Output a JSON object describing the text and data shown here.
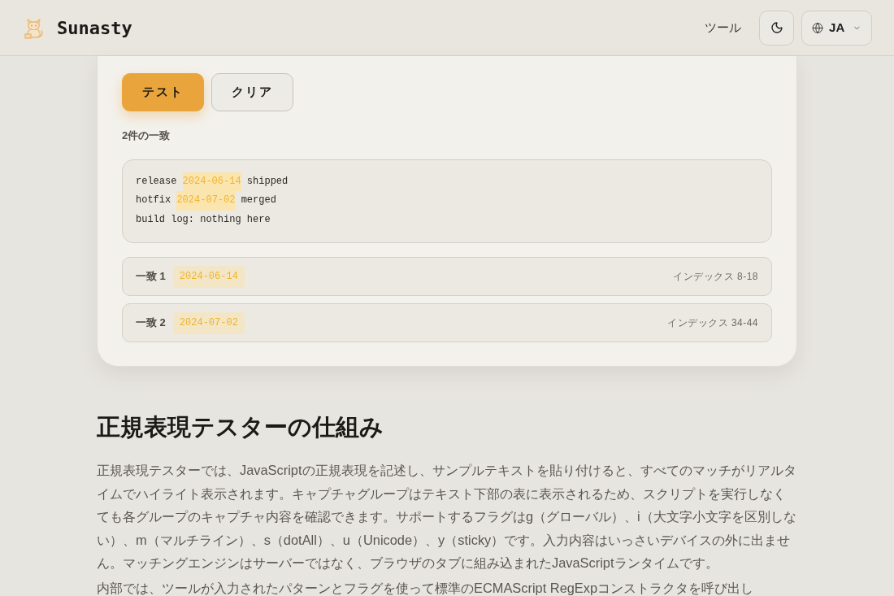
{
  "header": {
    "brand": "Sunasty",
    "nav": [
      {
        "label": "ツール"
      }
    ],
    "language": "JA"
  },
  "tester": {
    "buttons": [
      {
        "label": "テスト",
        "kind": "primary"
      },
      {
        "label": "クリア",
        "kind": "secondary"
      }
    ],
    "match_count": "2件の一致",
    "sample_lines": [
      [
        {
          "text": "release ",
          "highlighted": false
        },
        {
          "text": "2024-06-14",
          "highlighted": true
        },
        {
          "text": " shipped",
          "highlighted": false
        }
      ],
      [
        {
          "text": "hotfix ",
          "highlighted": false
        },
        {
          "text": "2024-07-02",
          "highlighted": true
        },
        {
          "text": " merged",
          "highlighted": false
        }
      ],
      [
        {
          "text": "build log: nothing here",
          "highlighted": false
        }
      ]
    ],
    "matches": [
      {
        "label": "一致 1",
        "value": "2024-06-14",
        "index": "インデックス 8-18"
      },
      {
        "label": "一致 2",
        "value": "2024-07-02",
        "index": "インデックス 34-44"
      }
    ]
  },
  "article": {
    "heading": "正規表現テスターの仕組み",
    "paragraphs": [
      "正規表現テスターでは、JavaScriptの正規表現を記述し、サンプルテキストを貼り付けると、すべてのマッチがリアルタイムでハイライト表示されます。キャプチャグループはテキスト下部の表に表示されるため、スクリプトを実行しなくても各グループのキャプチャ内容を確認できます。サポートするフラグはg（グローバル）、i（大文字小文字を区別しない）、m（マルチライン）、s（dotAll）、u（Unicode）、y（sticky）です。入力内容はいっさいデバイスの外に出ません。マッチングエンジンはサーバーではなく、ブラウザのタブに組み込まれたJavaScriptランタイムです。",
      "内部では、ツールが入力されたパターンとフラグを使って標準のECMAScript RegExpコンストラクタを呼び出し"
    ]
  }
}
